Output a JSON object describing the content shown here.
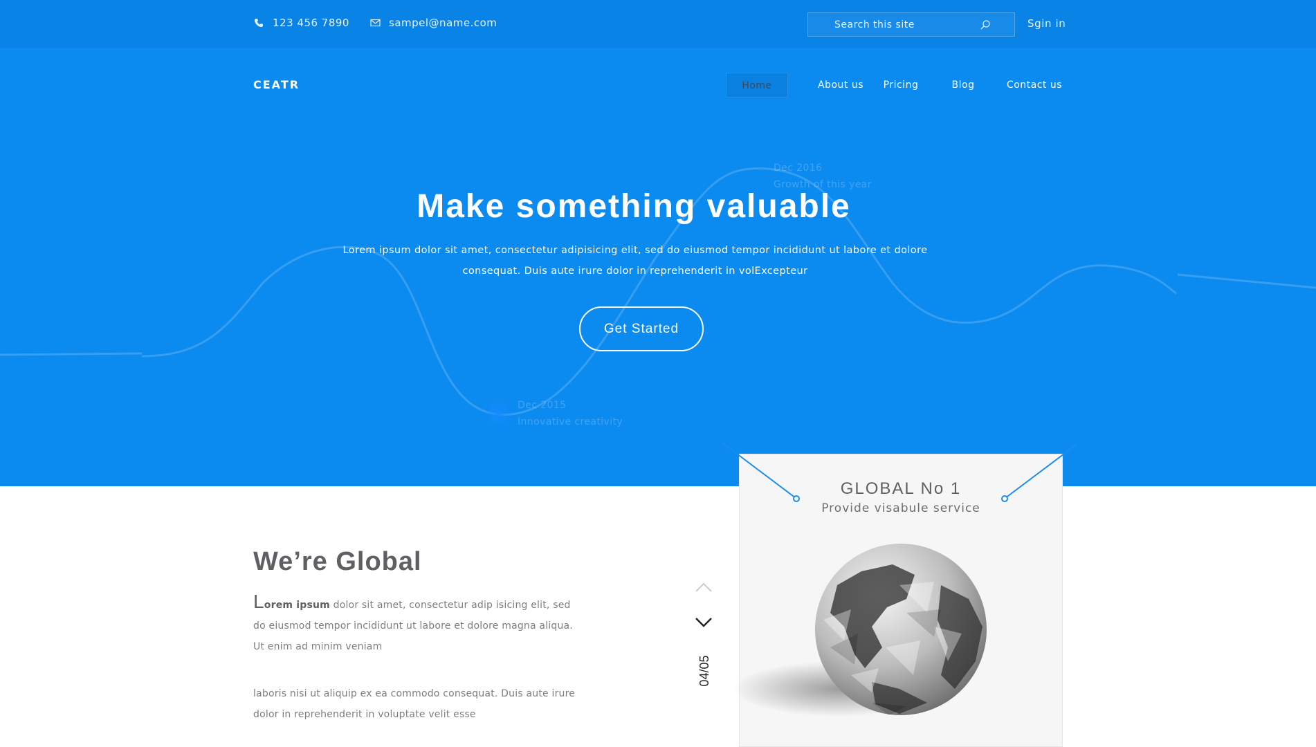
{
  "topbar": {
    "phone": "123 456 7890",
    "email": "sampel@name.com",
    "search_placeholder": "Search this site",
    "signin_label": "Sgin in",
    "phone_icon": "phone-icon",
    "mail_icon": "mail-icon",
    "search_icon": "search-icon"
  },
  "header": {
    "logo": "CEATR",
    "nav": [
      "Home",
      "About us",
      "Pricing",
      "Blog",
      "Contact us"
    ],
    "active_nav": "Home"
  },
  "hero": {
    "title": "Make something valuable",
    "subtitle_line1": "Lorem ipsum dolor sit amet, consectetur adipisicing elit, sed do eiusmod tempor incididunt ut labore et dolore",
    "subtitle_line2": "consequat. Duis aute irure dolor in reprehenderit in volExcepteur",
    "cta_label": "Get Started",
    "annotations": [
      {
        "date": "Dec 2016",
        "caption": "Growth of this year"
      },
      {
        "date": "Dec 2015",
        "caption": "Innovative creativity"
      }
    ]
  },
  "section": {
    "title": "We’re Global",
    "para1_cap": "L",
    "para1_lead": "orem ipsum",
    "para1_rest": " dolor sit amet, consectetur adip isicing elit, sed do eiusmod tempor incididunt ut labore et dolore magna aliqua. Ut enim ad minim veniam",
    "para2": "laboris nisi ut aliquip ex ea commodo consequat. Duis aute irure dolor in reprehenderit in voluptate velit esse",
    "counter": "04/05",
    "chevron_up_icon": "chevron-up-icon",
    "chevron_down_icon": "chevron-down-icon"
  },
  "card": {
    "title": "GLOBAL No 1",
    "subtitle": "Provide visabule service",
    "image": "globe-icon"
  },
  "colors": {
    "topbar": "#0a83e6",
    "hero": "#0b8af0",
    "accent": "#1a8cf0",
    "heading_gray": "#5f6064",
    "text_gray": "#7b7d80"
  }
}
